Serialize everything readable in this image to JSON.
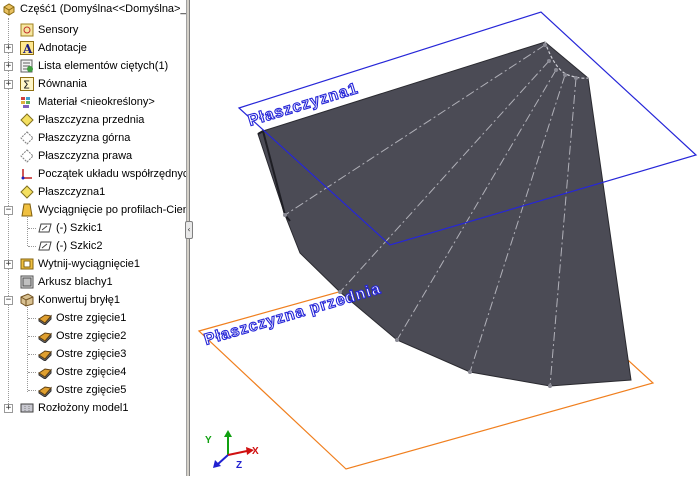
{
  "feature_tree": {
    "root_label": "Część1  (Domyślna<<Domyślna>_",
    "items": [
      {
        "label": "Sensory",
        "icon": "sensor-icon"
      },
      {
        "label": "Adnotacje",
        "icon": "annotation-icon"
      },
      {
        "label": "Lista elementów ciętych(1)",
        "icon": "cut-list-icon"
      },
      {
        "label": "Równania",
        "icon": "equation-icon"
      },
      {
        "label": "Materiał <nieokreślony>",
        "icon": "material-icon"
      },
      {
        "label": "Płaszczyzna przednia",
        "icon": "plane-icon"
      },
      {
        "label": "Płaszczyzna górna",
        "icon": "plane-icon"
      },
      {
        "label": "Płaszczyzna prawa",
        "icon": "plane-icon"
      },
      {
        "label": "Początek układu współrzędnyc",
        "icon": "origin-icon"
      },
      {
        "label": "Płaszczyzna1",
        "icon": "plane-icon"
      },
      {
        "label": "Wyciągnięcie po profilach-Cien",
        "icon": "loft-icon"
      },
      {
        "label": "(-) Szkic1",
        "icon": "sketch-icon"
      },
      {
        "label": "(-) Szkic2",
        "icon": "sketch-icon"
      },
      {
        "label": "Wytnij-wyciągnięcie1",
        "icon": "cut-extrude-icon"
      },
      {
        "label": "Arkusz blachy1",
        "icon": "sheet-metal-icon"
      },
      {
        "label": "Konwertuj bryłę1",
        "icon": "convert-solid-icon"
      },
      {
        "label": "Ostre zgięcie1",
        "icon": "sharp-bend-icon"
      },
      {
        "label": "Ostre zgięcie2",
        "icon": "sharp-bend-icon"
      },
      {
        "label": "Ostre zgięcie3",
        "icon": "sharp-bend-icon"
      },
      {
        "label": "Ostre zgięcie4",
        "icon": "sharp-bend-icon"
      },
      {
        "label": "Ostre zgięcie5",
        "icon": "sharp-bend-icon"
      },
      {
        "label": "Rozłożony model1",
        "icon": "flat-pattern-icon"
      }
    ]
  },
  "splitter": {
    "handle_glyph": "‹"
  },
  "viewport": {
    "plane_labels": {
      "top_plane": "Płaszczyzna1",
      "bottom_plane": "Płaszczyzna przednia"
    },
    "triad": {
      "x": "X",
      "y": "Y",
      "z": "Z"
    },
    "colors": {
      "part": "#4b4b55",
      "part_edge": "#2a2a30",
      "bend_lines": "#b0b0b8",
      "plane1": "#2626d8",
      "front_plane": "#f07f1e",
      "triad_x": "#d01010",
      "triad_y": "#10a010",
      "triad_z": "#2020d0"
    }
  }
}
